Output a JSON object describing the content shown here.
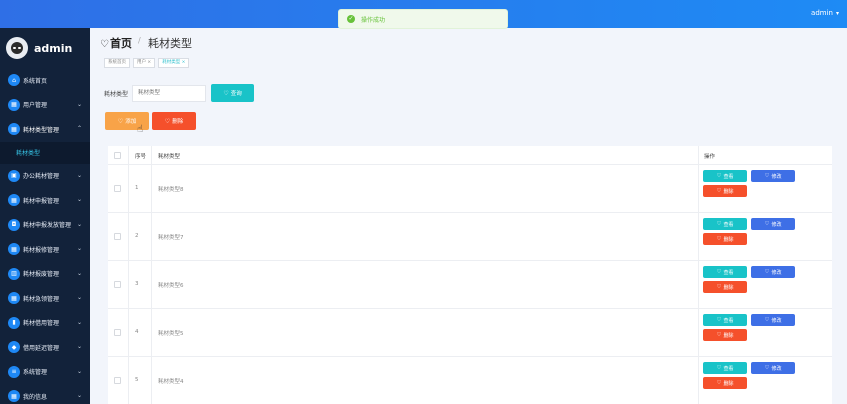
{
  "topbar": {
    "user": "admin",
    "caret": "▾"
  },
  "toast": {
    "text": "操作成功",
    "icon": "✓"
  },
  "brand": {
    "name": "admin"
  },
  "sidebar": {
    "items": [
      {
        "label": "系统首页",
        "icon": "home-icon",
        "glyph": "⌂",
        "arrow": ""
      },
      {
        "label": "用户管理",
        "icon": "grid-icon",
        "glyph": "▦",
        "arrow": "⌄"
      },
      {
        "label": "耗材类型管理",
        "icon": "grid-icon",
        "glyph": "▦",
        "arrow": "⌃"
      },
      {
        "label": "办公耗材管理",
        "icon": "box-icon",
        "glyph": "▣",
        "arrow": "⌄"
      },
      {
        "label": "耗材申报管理",
        "icon": "grid-icon",
        "glyph": "▦",
        "arrow": "⌄"
      },
      {
        "label": "耗材申报发放管理",
        "icon": "truck-icon",
        "glyph": "◘",
        "arrow": "⌄"
      },
      {
        "label": "耗材报修管理",
        "icon": "grid-icon",
        "glyph": "▦",
        "arrow": "⌄"
      },
      {
        "label": "耗材报废管理",
        "icon": "chart-icon",
        "glyph": "▥",
        "arrow": "⌄"
      },
      {
        "label": "耗材急领管理",
        "icon": "grid-icon",
        "glyph": "▦",
        "arrow": "⌄"
      },
      {
        "label": "耗材借用管理",
        "icon": "bar-chart-icon",
        "glyph": "▮",
        "arrow": "⌄"
      },
      {
        "label": "借用延迟管理",
        "icon": "shield-icon",
        "glyph": "◆",
        "arrow": "⌄"
      },
      {
        "label": "系统管理",
        "icon": "list-icon",
        "glyph": "≡",
        "arrow": "⌄"
      },
      {
        "label": "我的信息",
        "icon": "grid-icon",
        "glyph": "▦",
        "arrow": "⌄"
      }
    ],
    "sub_item": "耗材类型"
  },
  "header": {
    "home": "首页",
    "heart": "♡",
    "sep": "/",
    "title": "耗材类型"
  },
  "tags": [
    "系统首页",
    "用户 ×",
    "耗材类型 ×"
  ],
  "search": {
    "label": "耗材类型",
    "placeholder": "耗材类型",
    "button": "查询"
  },
  "actions": {
    "add": "添加",
    "delete": "删除"
  },
  "table": {
    "headers": {
      "index": "序号",
      "name": "耗材类型",
      "ops": "操作"
    },
    "ops": {
      "view": "查看",
      "edit": "修改",
      "delete": "删除"
    },
    "rows": [
      {
        "index": "1",
        "name": "耗材类型8"
      },
      {
        "index": "2",
        "name": "耗材类型7"
      },
      {
        "index": "3",
        "name": "耗材类型6"
      },
      {
        "index": "4",
        "name": "耗材类型5"
      },
      {
        "index": "5",
        "name": "耗材类型4"
      }
    ]
  },
  "colors": {
    "accent": "#19c3c8",
    "primary": "#3e6fe6",
    "danger": "#f5502b",
    "warning": "#f8a348",
    "sidebar": "#12223a"
  }
}
